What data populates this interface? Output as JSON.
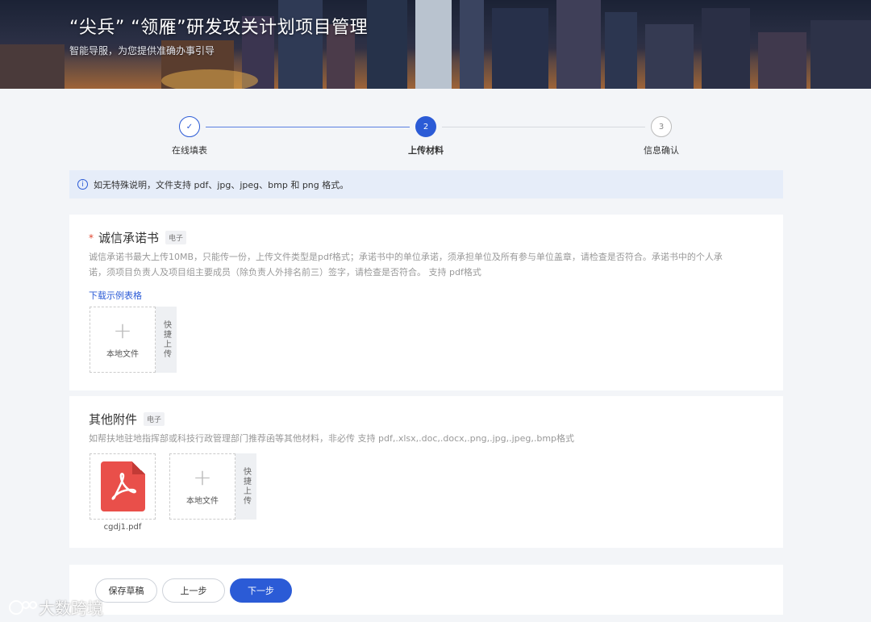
{
  "header": {
    "title": "“尖兵” “领雁”研发攻关计划项目管理",
    "subtitle": "智能导服，为您提供准确办事引导"
  },
  "steps": [
    {
      "number": "✓",
      "label": "在线填表",
      "status": "done"
    },
    {
      "number": "2",
      "label": "上传材料",
      "status": "active"
    },
    {
      "number": "3",
      "label": "信息确认",
      "status": "todo"
    }
  ],
  "info_bar": {
    "icon": "info-icon",
    "text": "如无特殊说明，文件支持 pdf、jpg、jpeg、bmp 和 png 格式。"
  },
  "section1": {
    "required_mark": "*",
    "title": "诚信承诺书",
    "tag": "电子",
    "description_line1": "诚信承诺书最大上传10MB，只能传一份，上传文件类型是pdf格式；承诺书中的单位承诺，须承担单位及所有参与单位盖章，请检查是否符合。承诺书中的个人承",
    "description_line2": "诺，须项目负责人及项目组主要成员（除负责人外排名前三）签字，请检查是否符合。   支持 pdf格式",
    "download_link": "下载示例表格",
    "upload_label": "本地文件",
    "quick_upload": "快捷上传"
  },
  "section2": {
    "title": "其他附件",
    "tag": "电子",
    "description": "如帮扶地驻地指挥部或科技行政管理部门推荐函等其他材料，非必传   支持 pdf,.xlsx,.doc,.docx,.png,.jpg,.jpeg,.bmp格式",
    "file_name": "cgdj1.pdf",
    "upload_label": "本地文件",
    "quick_upload": "快捷上传"
  },
  "actions": {
    "save_draft": "保存草稿",
    "prev": "上一步",
    "next": "下一步"
  },
  "watermark": "大数跨境",
  "colors": {
    "primary": "#2b5bd6",
    "info_bg": "#e6edf9",
    "required": "#e0452f",
    "pdf_red": "#e94f4a"
  }
}
